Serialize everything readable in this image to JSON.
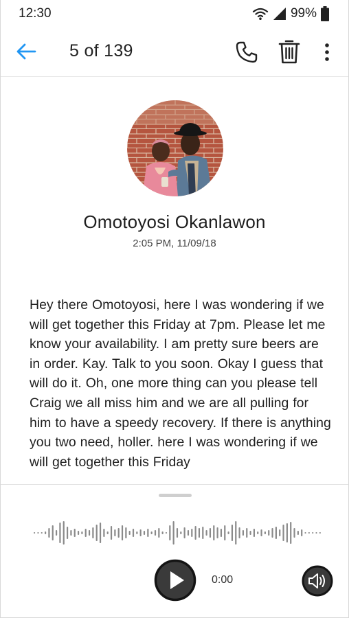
{
  "status_bar": {
    "time": "12:30",
    "battery": "99%",
    "icons": [
      "wifi-icon",
      "cell-signal-icon",
      "battery-icon"
    ]
  },
  "app_bar": {
    "counter": "5 of 139",
    "back_icon": "arrow-left-icon",
    "actions": [
      "phone-icon",
      "trash-icon",
      "more-vertical-icon"
    ],
    "accent_color": "#2196f3"
  },
  "message": {
    "contact_name": "Omotoyosi Okanlawon",
    "timestamp": "2:05 PM, 11/09/18",
    "transcript": "Hey there Omotoyosi, here I was wondering if we will get together this Friday at 7pm. Please let me know your availability.  I am pretty sure beers are in order.  Kay.  Talk to you soon.  Okay I guess that will do it.  Oh, one more thing can you please tell Craig we all miss him and we are all pulling for him to have a speedy recovery.  If there is anything you two need, holler. here I was wondering if we will get together this Friday"
  },
  "player": {
    "elapsed": "0:00",
    "play_icon": "play-icon",
    "speaker_icon": "speaker-icon",
    "progress": 0
  }
}
